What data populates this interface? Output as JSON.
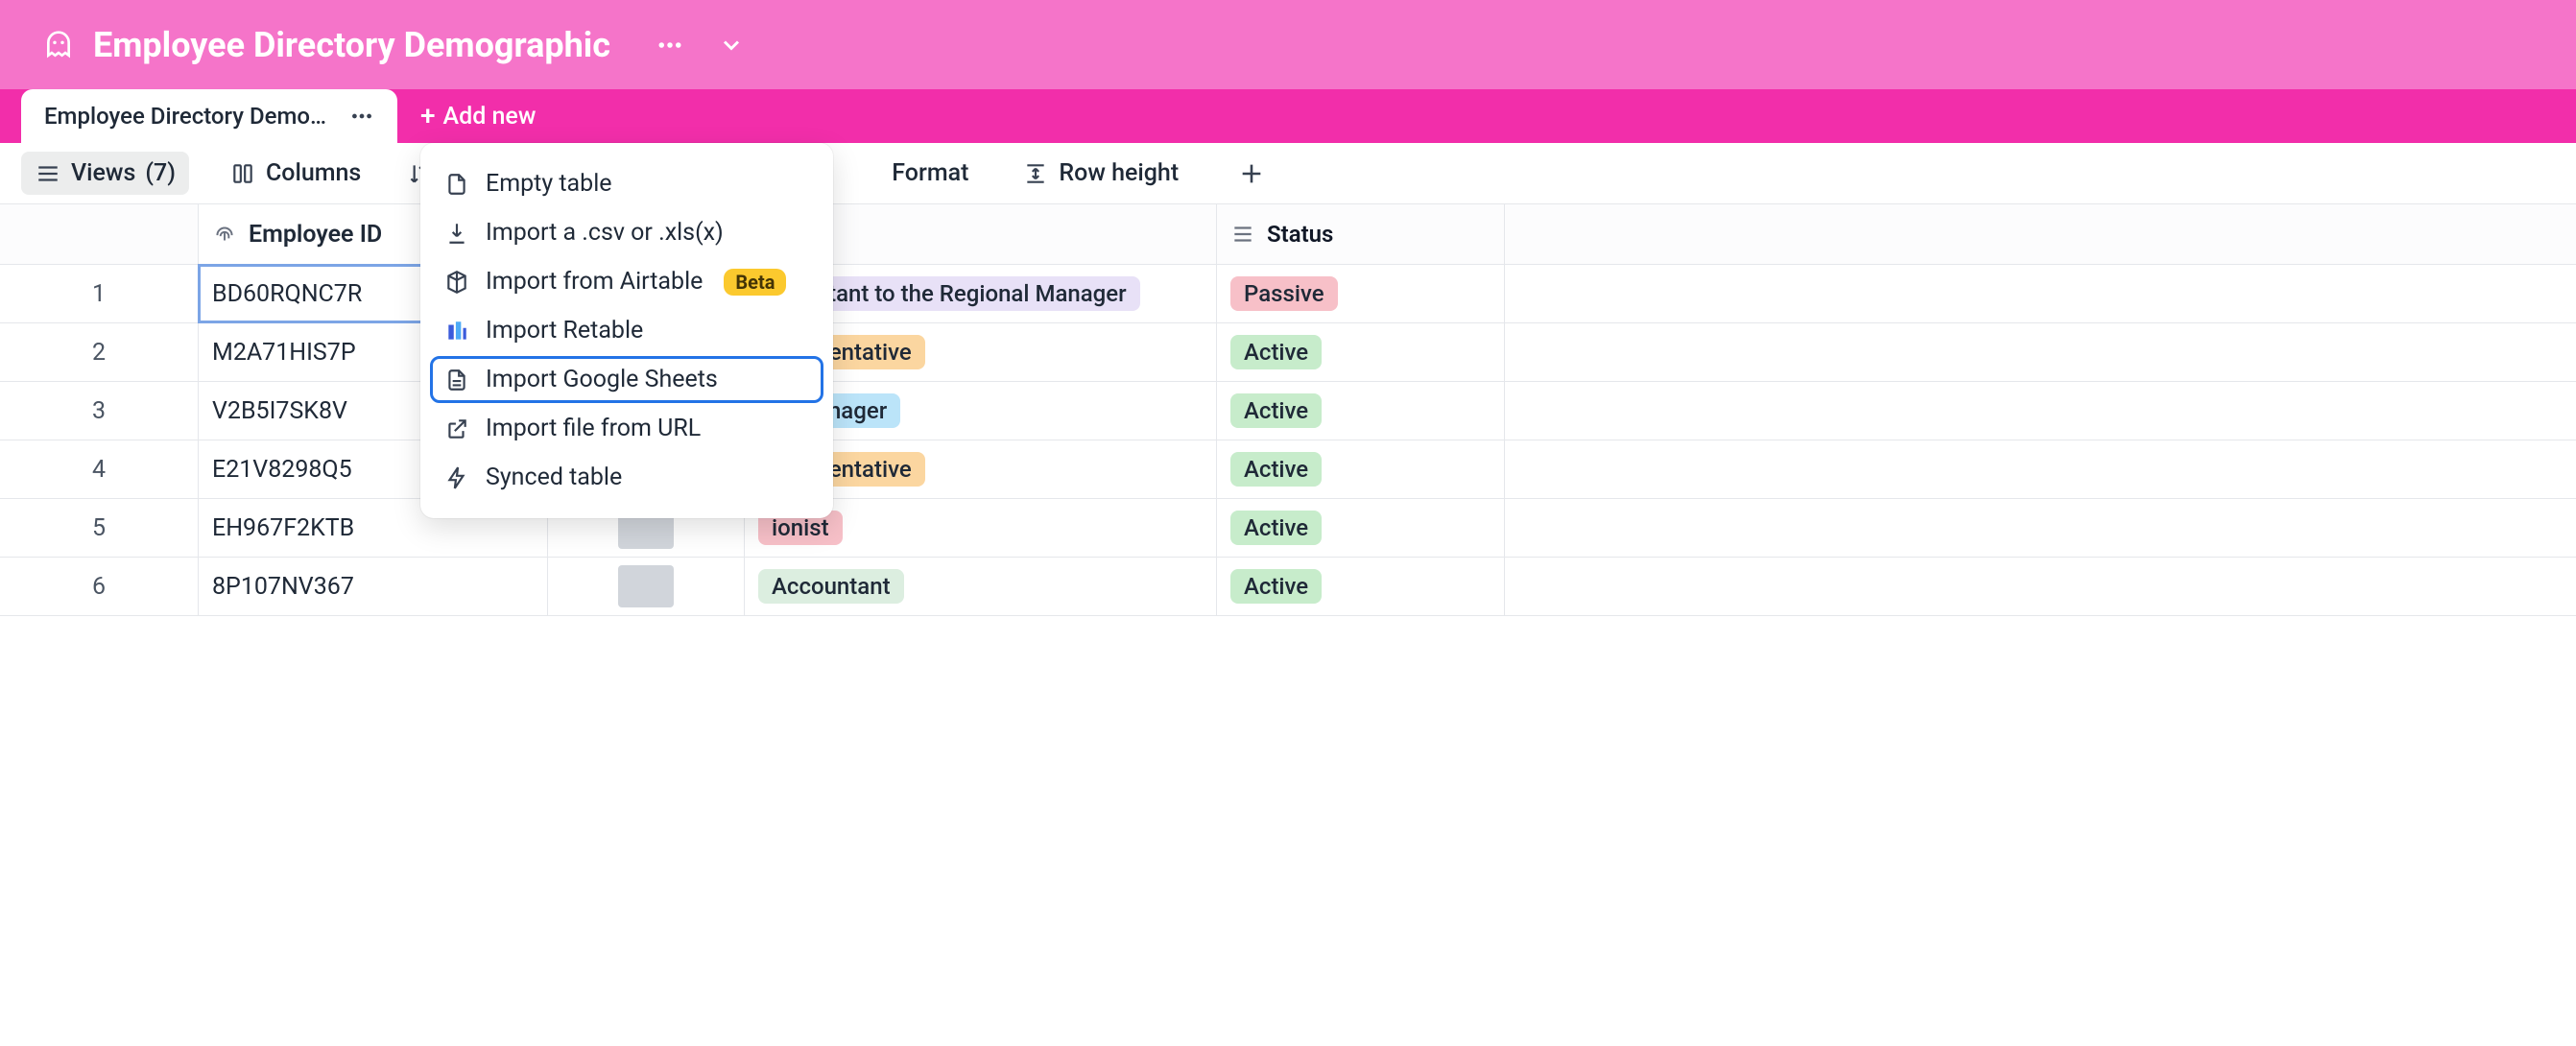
{
  "header": {
    "title": "Employee Directory Demographic"
  },
  "tabs": {
    "active_label": "Employee Directory Demog...",
    "add_new_label": "Add new"
  },
  "toolbar": {
    "views": {
      "label": "Views",
      "count": "(7)"
    },
    "columns": "Columns",
    "format": "Format",
    "row_height": "Row height"
  },
  "columns": {
    "employee_id": "Employee ID",
    "status": "Status"
  },
  "rows": [
    {
      "n": "1",
      "id": "BD60RQNC7R",
      "title": "Assistant to the Regional Manager",
      "title_bg": "#e8e1f7",
      "status": "Passive",
      "status_bg": "#f7c0c8"
    },
    {
      "n": "2",
      "id": "M2A71HIS7P",
      "title": "epresentative",
      "title_bg": "#fbd6a0",
      "status": "Active",
      "status_bg": "#c7eccb"
    },
    {
      "n": "3",
      "id": "V2B5I7SK8V",
      "title": "al Manager",
      "title_bg": "#bbe4f9",
      "status": "Active",
      "status_bg": "#c7eccb"
    },
    {
      "n": "4",
      "id": "E21V8298Q5",
      "title": "epresentative",
      "title_bg": "#fbd6a0",
      "status": "Active",
      "status_bg": "#c7eccb"
    },
    {
      "n": "5",
      "id": "EH967F2KTB",
      "title": "ionist",
      "title_bg": "#f7c0c8",
      "status": "Active",
      "status_bg": "#c7eccb"
    },
    {
      "n": "6",
      "id": "8P107NV367",
      "title": "Accountant",
      "title_bg": "#dceee0",
      "status": "Active",
      "status_bg": "#c7eccb"
    }
  ],
  "menu": {
    "items": [
      {
        "label": "Empty table",
        "icon": "file"
      },
      {
        "label": "Import a .csv or .xls(x)",
        "icon": "download"
      },
      {
        "label": "Import from Airtable",
        "icon": "cube",
        "beta": "Beta"
      },
      {
        "label": "Import Retable",
        "icon": "retable"
      },
      {
        "label": "Import Google Sheets",
        "icon": "sheet",
        "highlighted": true
      },
      {
        "label": "Import file from URL",
        "icon": "link-ext"
      },
      {
        "label": "Synced table",
        "icon": "bolt"
      }
    ]
  }
}
